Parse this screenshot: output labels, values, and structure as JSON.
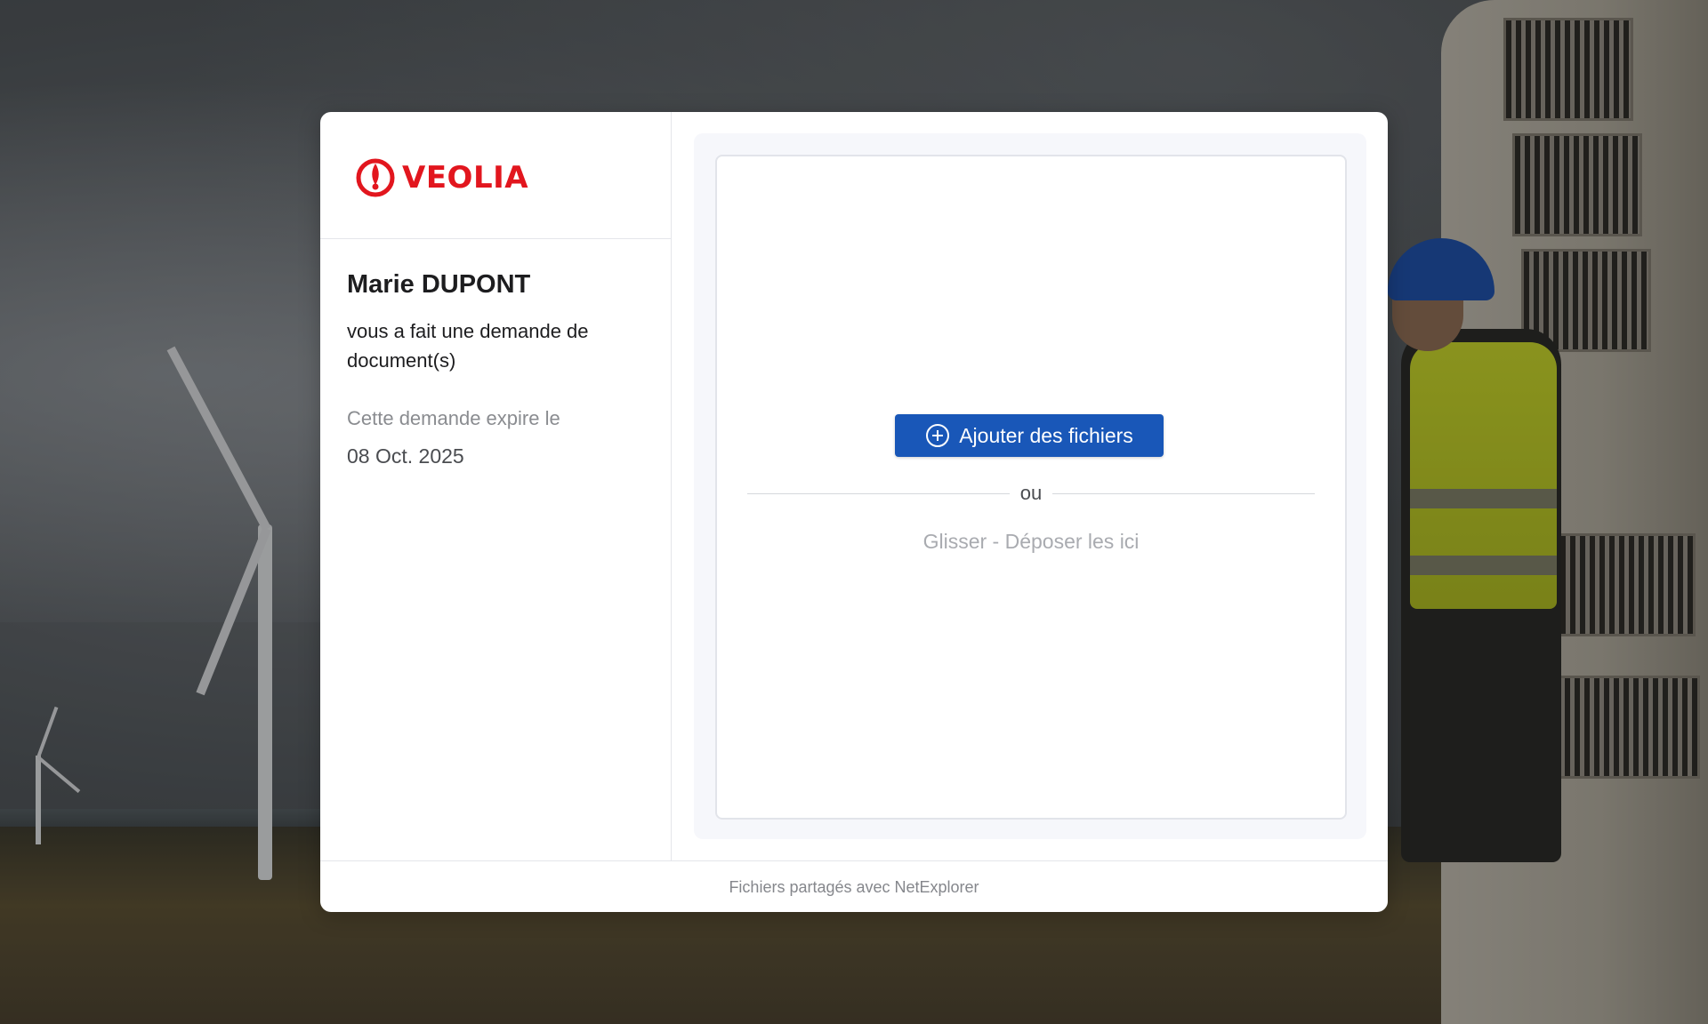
{
  "brand": {
    "name": "VEOLIA",
    "color": "#e2161e"
  },
  "request": {
    "requester_name": "Marie DUPONT",
    "message": "vous a fait une demande de document(s)",
    "expiry_label": "Cette demande expire le",
    "expiry_date": "08 Oct. 2025"
  },
  "upload": {
    "button_label": "Ajouter des fichiers",
    "button_icon": "plus-circle-icon",
    "separator": "ou",
    "drop_hint": "Glisser - Déposer les ici",
    "accent": "#1957b8"
  },
  "footer": {
    "text": "Fichiers partagés avec NetExplorer"
  }
}
